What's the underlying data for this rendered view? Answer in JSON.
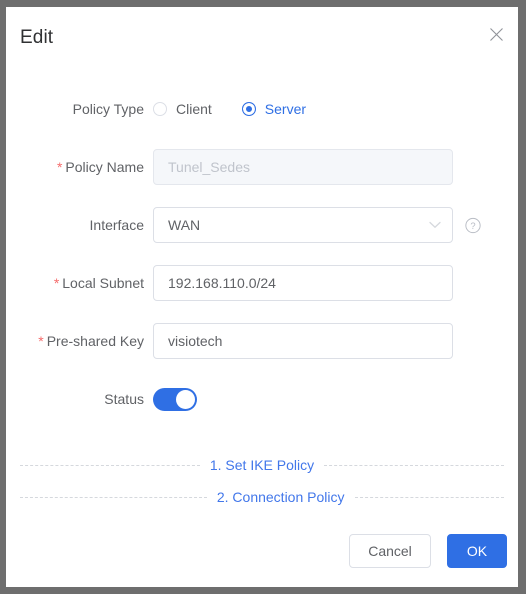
{
  "dialog": {
    "title": "Edit",
    "close_icon": "close-icon"
  },
  "form": {
    "policy_type": {
      "label": "Policy Type",
      "options": [
        {
          "label": "Client",
          "selected": false
        },
        {
          "label": "Server",
          "selected": true
        }
      ]
    },
    "policy_name": {
      "label": "Policy Name",
      "required": "*",
      "value": "",
      "placeholder": "Tunel_Sedes",
      "disabled": true
    },
    "interface": {
      "label": "Interface",
      "required": "",
      "value": "WAN",
      "options": [
        "WAN"
      ],
      "help_icon": "question-circle-icon",
      "arrow_icon": "chevron-down-icon"
    },
    "local_subnet": {
      "label": "Local Subnet",
      "required": "*",
      "value": "192.168.110.0/24",
      "placeholder": ""
    },
    "pre_shared_key": {
      "label": "Pre-shared Key",
      "required": "*",
      "value": "visiotech",
      "placeholder": ""
    },
    "status": {
      "label": "Status",
      "on": true
    }
  },
  "links": [
    {
      "text": "1. Set IKE Policy"
    },
    {
      "text": "2. Connection Policy"
    }
  ],
  "footer": {
    "cancel_label": "Cancel",
    "ok_label": "OK"
  },
  "colors": {
    "accent": "#2f6fe4",
    "link": "#4277ea",
    "required": "#f56c6c",
    "label_text": "#606266",
    "border": "#dcdfe6",
    "disabled_bg": "#f5f7fa",
    "backdrop": "#6e6e6e"
  }
}
